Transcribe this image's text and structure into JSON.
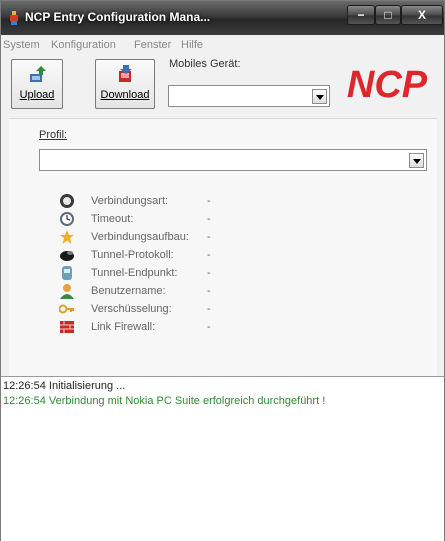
{
  "window": {
    "title": "NCP Entry Configuration Mana...",
    "min_glyph": "−",
    "max_glyph": "□",
    "close_glyph": "X"
  },
  "menu": [
    "System",
    "Konfiguration",
    "Fenster",
    "Hilfe"
  ],
  "toolbar": {
    "upload_label": "Upload",
    "download_label": "Download",
    "mobile_label": "Mobiles Gerät:",
    "mobile_value": ""
  },
  "logo": {
    "text": "NCP",
    "color": "#e0262d"
  },
  "profile": {
    "label": "Profil:",
    "value": ""
  },
  "info_rows": [
    {
      "icon": "dial-icon",
      "label": "Verbindungsart:",
      "value": "-"
    },
    {
      "icon": "clock-icon",
      "label": "Timeout:",
      "value": "-"
    },
    {
      "icon": "star-icon",
      "label": "Verbindungsaufbau:",
      "value": "-"
    },
    {
      "icon": "tunnel-icon",
      "label": "Tunnel-Protokoll:",
      "value": "-"
    },
    {
      "icon": "endpoint-icon",
      "label": "Tunnel-Endpunkt:",
      "value": "-"
    },
    {
      "icon": "user-icon",
      "label": "Benutzername:",
      "value": "-"
    },
    {
      "icon": "key-icon",
      "label": "Verschüsselung:",
      "value": "-"
    },
    {
      "icon": "firewall-icon",
      "label": "Link Firewall:",
      "value": "-"
    }
  ],
  "log": [
    {
      "time": "12:26:54",
      "text": "Initialisierung ...",
      "color": "#000000"
    },
    {
      "time": "12:26:54",
      "text": "Verbindung mit Nokia PC Suite erfolgreich durchgeführt !",
      "color": "#2e8b2e"
    }
  ]
}
